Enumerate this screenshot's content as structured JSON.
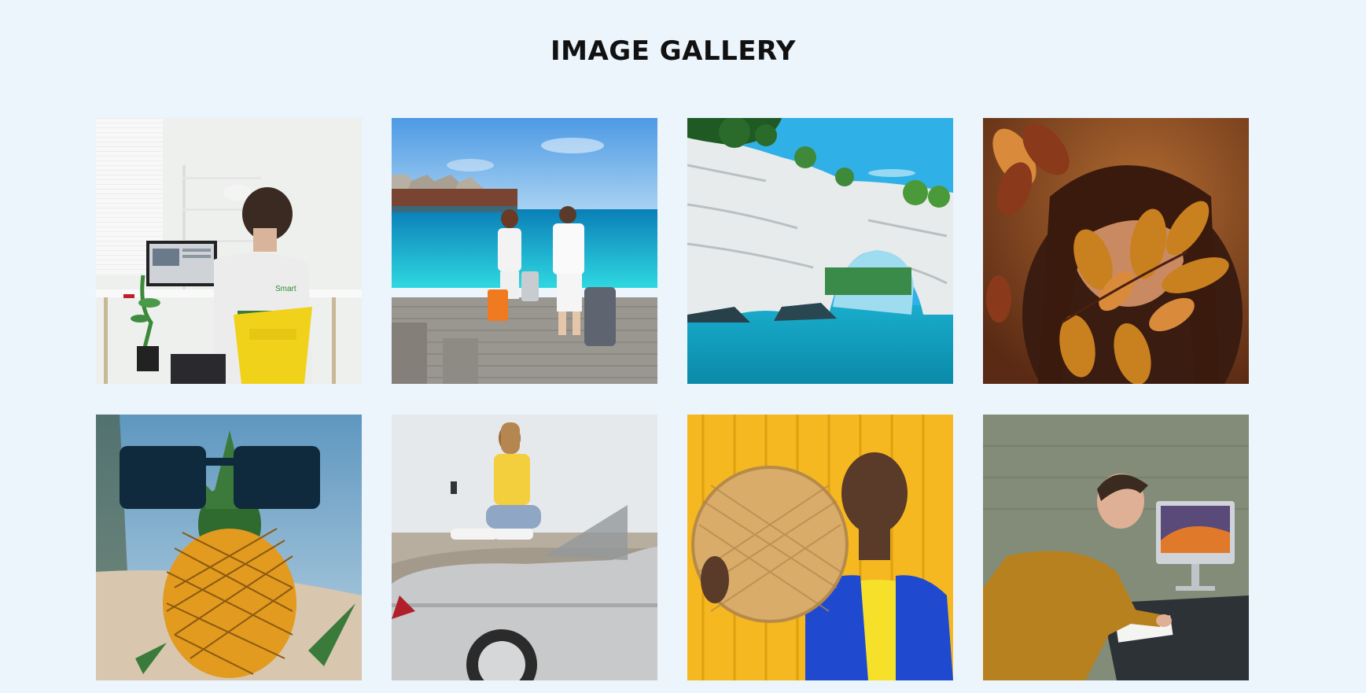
{
  "title": "IMAGE GALLERY",
  "gallery": {
    "images": [
      {
        "name": "person-working-laptop",
        "alt": "Person working at laptop with yellow chair"
      },
      {
        "name": "couple-pier-luggage",
        "alt": "Couple walking on pier with luggage"
      },
      {
        "name": "rock-arch-sea",
        "alt": "Rock arch over turquoise sea"
      },
      {
        "name": "woman-autumn-leaves",
        "alt": "Woman hiding face behind autumn leaves"
      },
      {
        "name": "pineapple-sunglasses",
        "alt": "Pineapple wearing sunglasses in sand"
      },
      {
        "name": "woman-on-car",
        "alt": "Woman sitting on convertible car using phone"
      },
      {
        "name": "woman-straw-hat",
        "alt": "Woman with straw hat on yellow background"
      },
      {
        "name": "man-writing-desk",
        "alt": "Man writing at desk with computer"
      }
    ]
  },
  "colors": {
    "background": "#ecf4fc",
    "title": "#111111"
  }
}
